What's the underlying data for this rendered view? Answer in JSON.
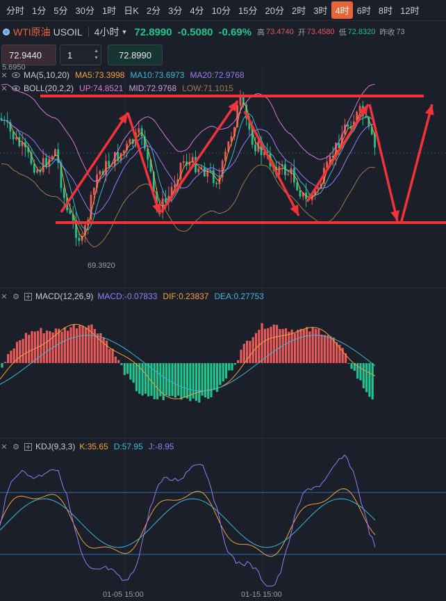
{
  "tabs": [
    "分时",
    "1分",
    "5分",
    "30分",
    "1时",
    "日K",
    "2分",
    "3分",
    "4分",
    "10分",
    "15分",
    "20分",
    "2时",
    "3时",
    "4时",
    "6时",
    "8时",
    "12时"
  ],
  "active_tab_index": 14,
  "quote": {
    "name": "WTI原油",
    "code": "USOIL",
    "period": "4小时",
    "price": "72.8990",
    "change": "-0.5080",
    "change_pct": "-0.69%",
    "high_label": "高",
    "high": "73.4740",
    "open_label": "开",
    "open": "73.4580",
    "low_label": "低",
    "low": "72.8320",
    "prev_label": "昨收",
    "prev": "73"
  },
  "order": {
    "price_left": "72.9440",
    "qty": "1",
    "price_right": "72.8990"
  },
  "price_top_label": "5.6950",
  "low_marker": "69.3920",
  "ma_legend": {
    "name": "MA(5,10,20)",
    "ma5": "MA5:73.3998",
    "ma10": "MA10:73.6973",
    "ma20": "MA20:72.9768"
  },
  "boll_legend": {
    "name": "BOLL(20,2,2)",
    "up": "UP:74.8521",
    "mid": "MID:72.9768",
    "low": "LOW:71.1015"
  },
  "macd_legend": {
    "name": "MACD(12,26,9)",
    "macd": "MACD:-0.07833",
    "dif": "DIF:0.23837",
    "dea": "DEA:0.27753"
  },
  "kdj_legend": {
    "name": "KDJ(9,3,3)",
    "k": "K:35.65",
    "d": "D:57.95",
    "j": "J:-8.95"
  },
  "x_labels": [
    "01-05 15:00",
    "01-15 15:00"
  ],
  "colors": {
    "up": "#e85a5a",
    "down": "#1fc48f",
    "accent": "#e8643a",
    "ma5": "#f0a33c",
    "ma10": "#3fb8d8",
    "ma20": "#9a7cf0",
    "annotation": "#f2333a"
  }
}
